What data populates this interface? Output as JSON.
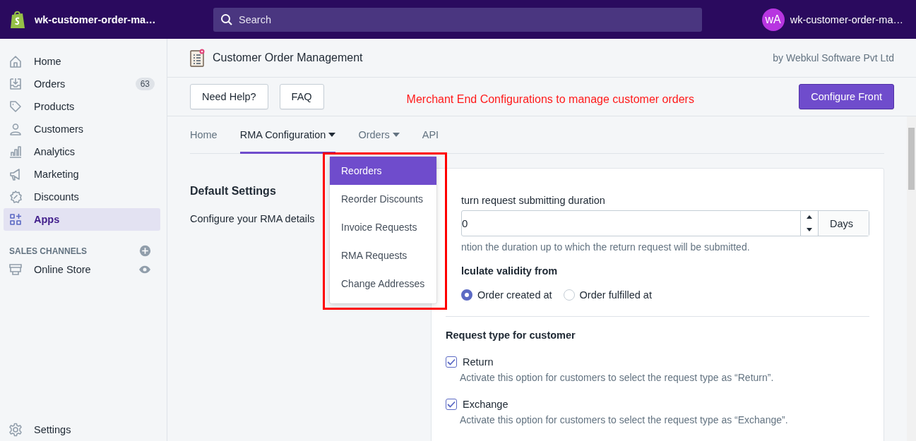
{
  "topbar": {
    "store_name": "wk-customer-order-ma…",
    "search": {
      "placeholder": "Search"
    },
    "avatar": "wA",
    "account": "wk-customer-order-ma…"
  },
  "sidebar": {
    "items": [
      {
        "label": "Home",
        "selected": false
      },
      {
        "label": "Orders",
        "badge": "63",
        "selected": false
      },
      {
        "label": "Products",
        "selected": false
      },
      {
        "label": "Customers",
        "selected": false
      },
      {
        "label": "Analytics",
        "selected": false
      },
      {
        "label": "Marketing",
        "selected": false
      },
      {
        "label": "Discounts",
        "selected": false
      },
      {
        "label": "Apps",
        "selected": true
      }
    ],
    "sales_channels": {
      "heading": "SALES CHANNELS",
      "items": [
        {
          "label": "Online Store"
        }
      ]
    },
    "settings": "Settings"
  },
  "app_header": {
    "title": "Customer Order Management",
    "vendor": "by Webkul Software Pvt Ltd"
  },
  "toolbar": {
    "buttons": [
      "Need Help?",
      "FAQ"
    ],
    "note": "Merchant End Configurations to manage customer orders",
    "primary_button": "Configure Front"
  },
  "tabs": [
    {
      "label": "Home",
      "selected": false,
      "dropdown": false
    },
    {
      "label": "RMA Configuration",
      "selected": true,
      "dropdown": true
    },
    {
      "label": "Orders",
      "selected": false,
      "dropdown": true
    },
    {
      "label": "API",
      "selected": false,
      "dropdown": false
    }
  ],
  "orders_menu": {
    "items": [
      {
        "label": "Reorders",
        "selected": true
      },
      {
        "label": "Reorder Discounts",
        "selected": false
      },
      {
        "label": "Invoice Requests",
        "selected": false
      },
      {
        "label": "RMA Requests",
        "selected": false
      },
      {
        "label": "Change Addresses",
        "selected": false
      }
    ]
  },
  "section": {
    "title": "Default Settings",
    "description": "Configure your RMA details"
  },
  "card": {
    "duration": {
      "label": "turn request submitting duration",
      "value": "0",
      "unit": "Days",
      "help": "ntion the duration up to which the return request will be submitted."
    },
    "validity": {
      "label": "lculate validity from",
      "options": [
        {
          "label": "Order created at",
          "selected": true
        },
        {
          "label": "Order fulfilled at",
          "selected": false
        }
      ]
    },
    "request_types": {
      "title": "Request type for customer",
      "options": [
        {
          "label": "Return",
          "checked": true,
          "description": "Activate this option for customers to select the request type as “Return”."
        },
        {
          "label": "Exchange",
          "checked": true,
          "description": "Activate this option for customers to select the request type as “Exchange”."
        }
      ]
    }
  }
}
